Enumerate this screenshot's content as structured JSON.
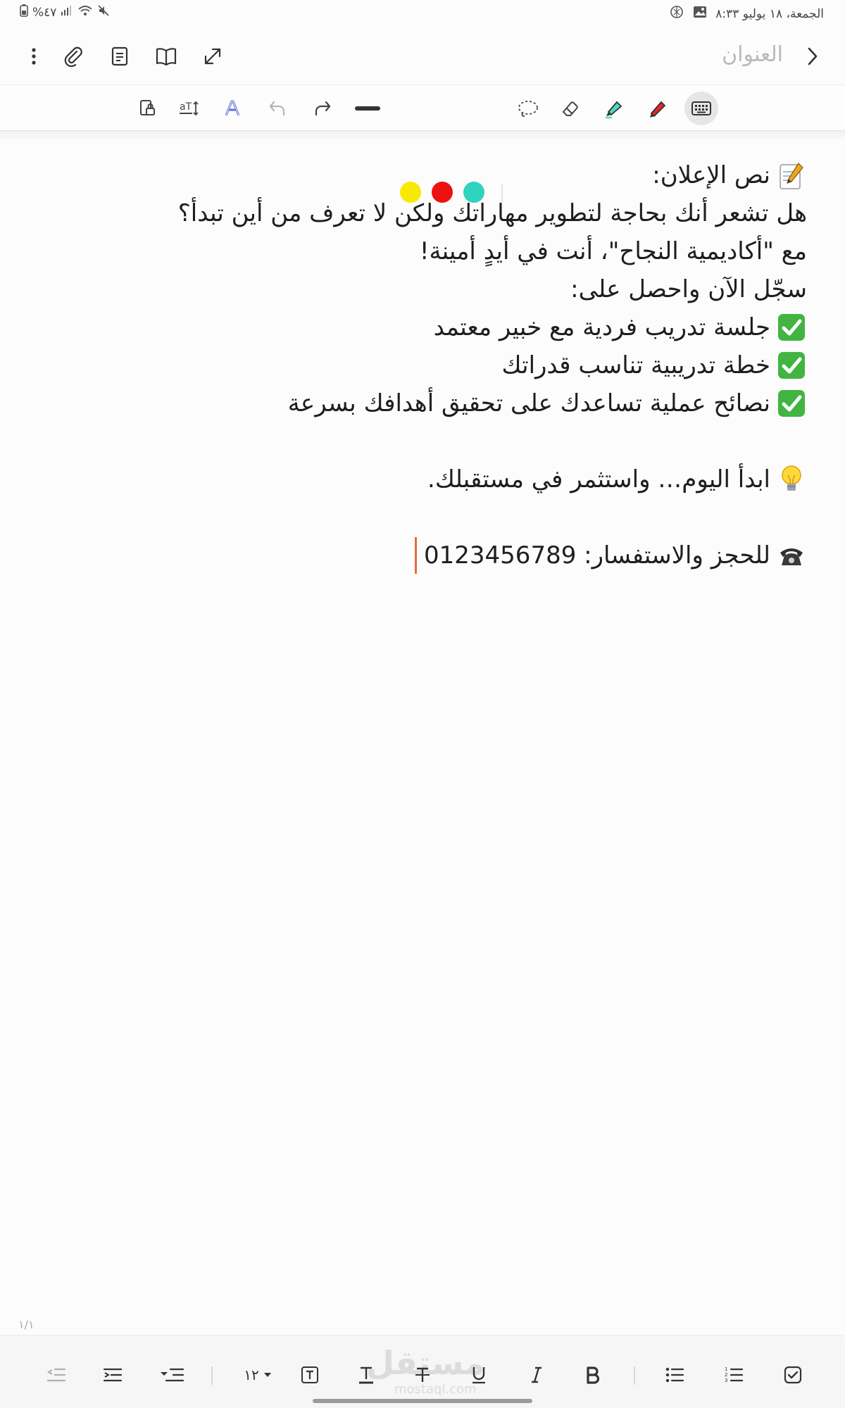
{
  "status_bar": {
    "date_time": "الجمعة، ١٨ يوليو ٨:٣٣",
    "battery": "%٤٧"
  },
  "header": {
    "title_placeholder": "العنوان"
  },
  "note": {
    "lines": [
      "نص الإعلان:",
      "هل تشعر أنك بحاجة لتطوير مهاراتك ولكن لا تعرف من أين تبدأ؟",
      "مع \"أكاديمية النجاح\"، أنت في أيدٍ أمينة!",
      "سجّل الآن واحصل على:",
      "جلسة تدريب فردية مع خبير معتمد",
      "خطة تدريبية تناسب قدراتك",
      "نصائح عملية تساعدك على تحقيق أهدافك بسرعة",
      "ابدأ اليوم… واستثمر في مستقبلك.",
      "للحجز والاستفسار: 0123456789"
    ]
  },
  "page_indicator": "١/١",
  "font_size": "١٢",
  "watermark": {
    "text": "مستقل",
    "domain": "mostaql.com"
  },
  "colors": {
    "pen_yellow": "#f7ea00",
    "pen_red": "#ee1111",
    "pen_teal": "#2fd3bf",
    "caret": "#e86a3d"
  }
}
